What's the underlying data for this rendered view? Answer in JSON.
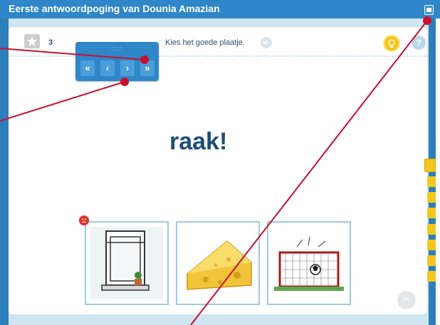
{
  "window": {
    "title": "Eerste antwoordpoging van Dounia Amazian"
  },
  "exercise": {
    "question_number": "3",
    "instruction": "Kies het goede plaatje.",
    "word": "raak!",
    "ok_label": "OK"
  },
  "nav_panel": {
    "grip": "::::",
    "first_label": "«",
    "prev_label": "‹",
    "next_label": "›",
    "last_label": "»"
  },
  "help": {
    "label": "?"
  },
  "choices": [
    {
      "name": "window",
      "selected_wrong": true
    },
    {
      "name": "cheese",
      "selected_wrong": false
    },
    {
      "name": "goal",
      "selected_wrong": false
    }
  ],
  "progress": {
    "total": 8,
    "current": 1
  },
  "colors": {
    "accent": "#2f86c8",
    "wrong": "#e2312c",
    "hint": "#f5c61f",
    "annotation": "#c8102e"
  }
}
